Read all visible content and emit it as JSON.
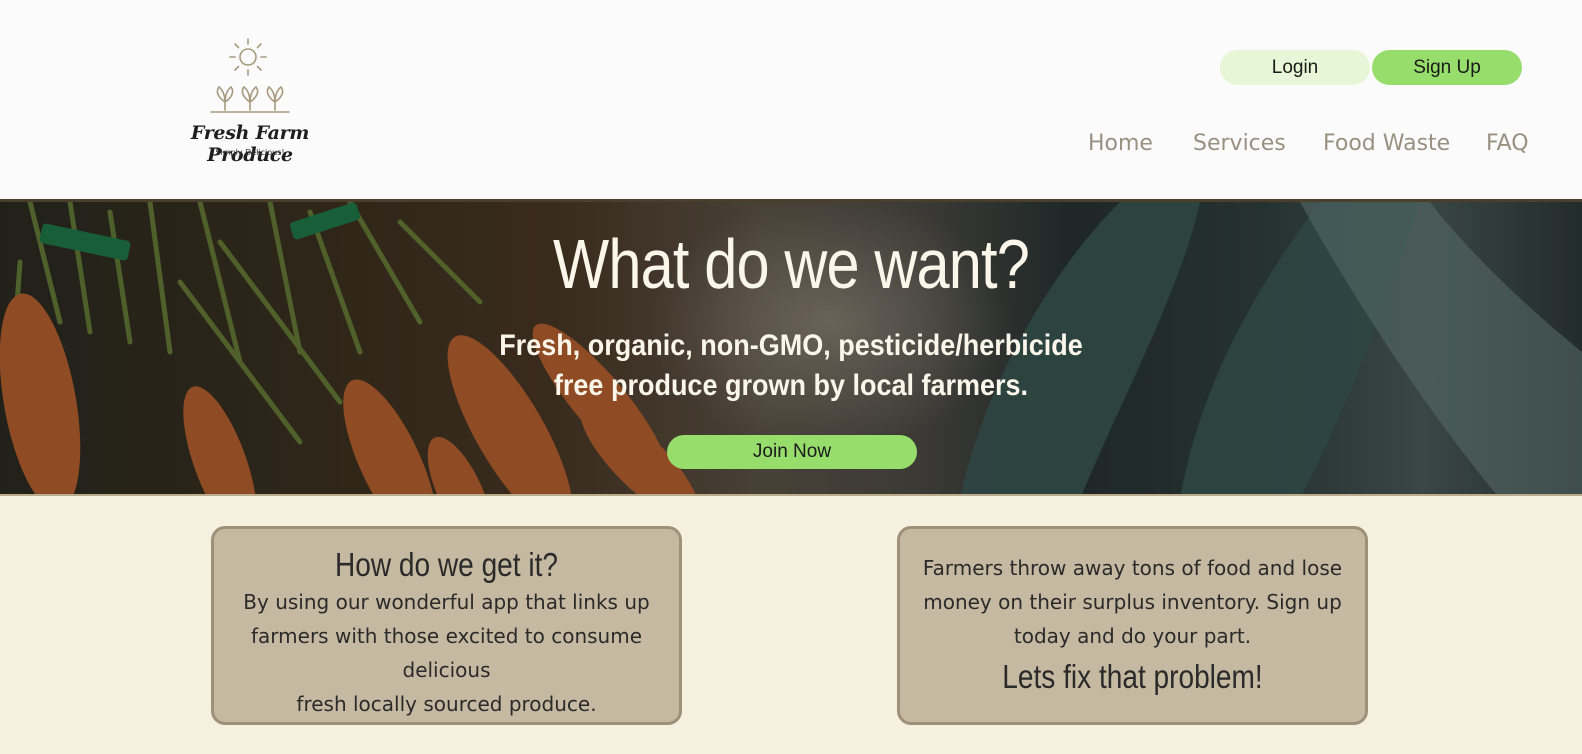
{
  "logo": {
    "title": "Fresh Farm Produce",
    "tagline": "Simply Delicious!",
    "icon": "sun-and-sprouts-icon"
  },
  "auth": {
    "login_label": "Login",
    "signup_label": "Sign Up"
  },
  "nav": {
    "items": [
      {
        "label": "Home"
      },
      {
        "label": "Services"
      },
      {
        "label": "Food Waste"
      },
      {
        "label": "FAQ"
      }
    ]
  },
  "hero": {
    "title": "What do we want?",
    "subtitle": "Fresh, organic, non-GMO, pesticide/herbicide free produce grown by local farmers.",
    "join_label": "Join Now"
  },
  "cards": [
    {
      "title": "How do we get it?",
      "text_line1": "By using our wonderful app that links up farmers with those excited to consume delicious",
      "text_line2": "fresh locally sourced produce."
    },
    {
      "text": "Farmers throw away tons of food and lose money on their surplus inventory. Sign up today and do your part.",
      "title": "Lets fix that problem!"
    }
  ],
  "colors": {
    "accent_green": "#97dd6c",
    "light_green": "#e7f6d6",
    "nav_text": "#9a9080",
    "card_bg": "#c6b9a1",
    "page_bg": "#f6f0e0"
  }
}
